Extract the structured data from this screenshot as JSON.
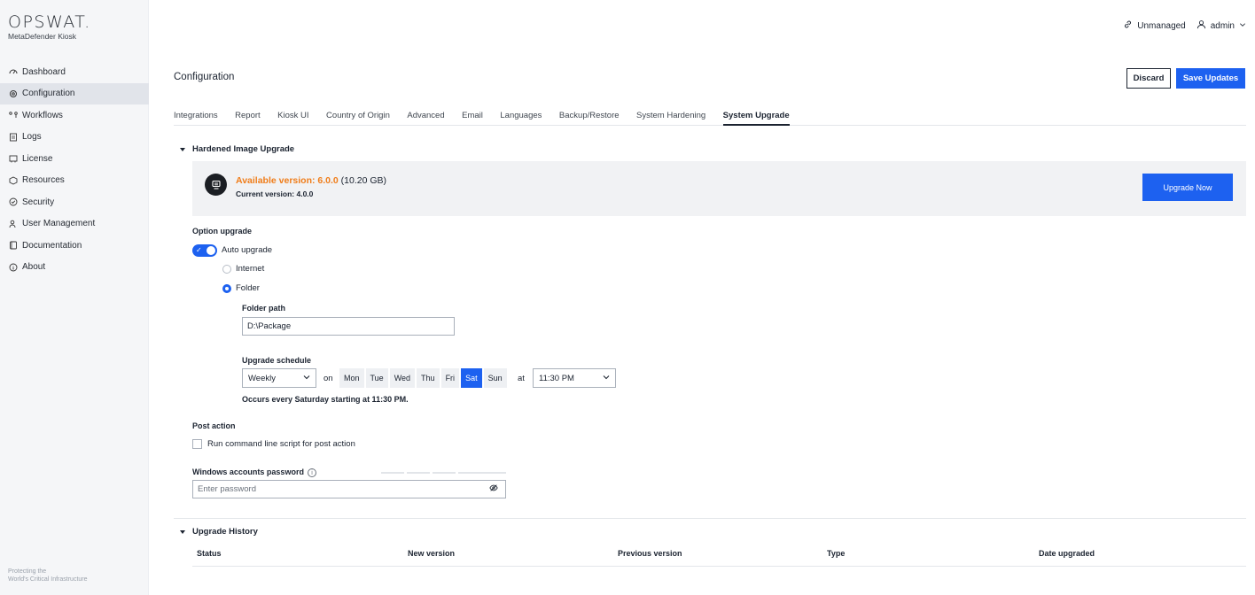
{
  "brand": {
    "name": "OPSWAT.",
    "product": "MetaDefender Kiosk",
    "tagline_1": "Protecting the",
    "tagline_2": "World's Critical Infrastructure"
  },
  "sidebar": {
    "items": [
      {
        "label": "Dashboard",
        "icon": "dashboard-icon",
        "active": false
      },
      {
        "label": "Configuration",
        "icon": "gear-icon",
        "active": true
      },
      {
        "label": "Workflows",
        "icon": "workflow-icon",
        "active": false
      },
      {
        "label": "Logs",
        "icon": "logs-icon",
        "active": false
      },
      {
        "label": "License",
        "icon": "license-icon",
        "active": false
      },
      {
        "label": "Resources",
        "icon": "resources-icon",
        "active": false
      },
      {
        "label": "Security",
        "icon": "shield-icon",
        "active": false
      },
      {
        "label": "User Management",
        "icon": "users-icon",
        "active": false
      },
      {
        "label": "Documentation",
        "icon": "book-icon",
        "active": false
      },
      {
        "label": "About",
        "icon": "info-icon",
        "active": false
      }
    ]
  },
  "topbar": {
    "managed_label": "Unmanaged",
    "user_label": "admin"
  },
  "header": {
    "title": "Configuration",
    "discard_label": "Discard",
    "save_label": "Save Updates"
  },
  "tabs": [
    {
      "label": "Integrations",
      "active": false
    },
    {
      "label": "Report",
      "active": false
    },
    {
      "label": "Kiosk UI",
      "active": false
    },
    {
      "label": "Country of Origin",
      "active": false
    },
    {
      "label": "Advanced",
      "active": false
    },
    {
      "label": "Email",
      "active": false
    },
    {
      "label": "Languages",
      "active": false
    },
    {
      "label": "Backup/Restore",
      "active": false
    },
    {
      "label": "System Hardening",
      "active": false
    },
    {
      "label": "System Upgrade",
      "active": true
    }
  ],
  "hardened": {
    "section_title": "Hardened Image Upgrade",
    "available_prefix": "Available version: 6.0.0",
    "available_size": " (10.20 GB)",
    "current_version": "Current version: 4.0.0",
    "upgrade_button": "Upgrade Now"
  },
  "option": {
    "title": "Option upgrade",
    "auto_upgrade_label": "Auto upgrade",
    "auto_upgrade_on": true,
    "radio_internet": "Internet",
    "radio_folder": "Folder",
    "selected_source": "Folder",
    "folder_path_label": "Folder path",
    "folder_path_value": "D:\\Package",
    "schedule_label": "Upgrade schedule",
    "frequency": "Weekly",
    "on_label": "on",
    "days": [
      "Mon",
      "Tue",
      "Wed",
      "Thu",
      "Fri",
      "Sat",
      "Sun"
    ],
    "selected_day": "Sat",
    "at_label": "at",
    "time": "11:30 PM",
    "summary": "Occurs every Saturday starting at 11:30 PM."
  },
  "post_action": {
    "title": "Post action",
    "checkbox_label": "Run command line script for post action",
    "checked": false,
    "password_label": "Windows accounts password",
    "password_placeholder": "Enter password"
  },
  "history": {
    "section_title": "Upgrade History",
    "columns": [
      "Status",
      "New version",
      "Previous version",
      "Type",
      "Date upgraded"
    ]
  },
  "colors": {
    "accent": "#1d61f0",
    "available": "#f07d1a"
  }
}
